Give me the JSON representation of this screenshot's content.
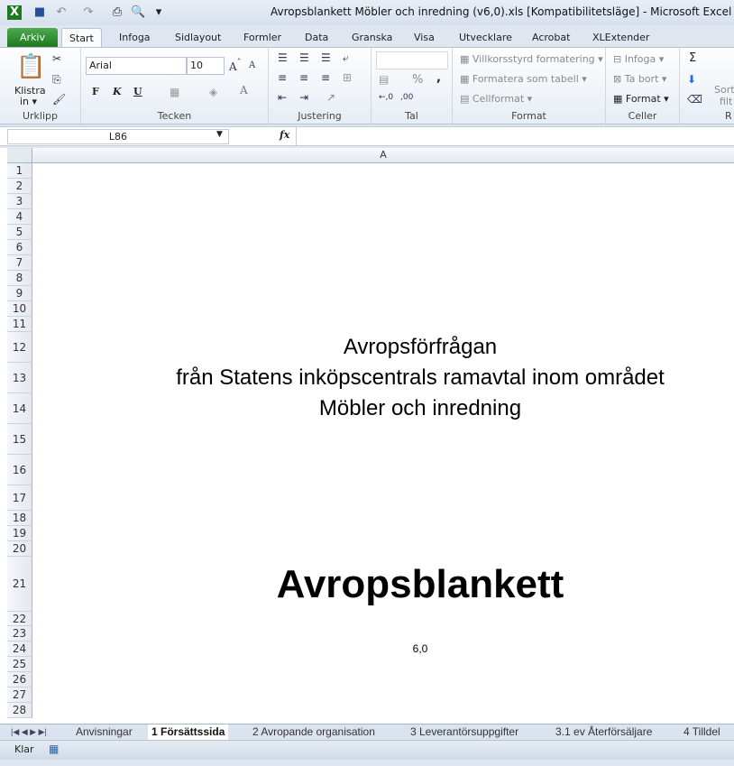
{
  "window": {
    "title": "Avropsblankett Möbler och inredning (v6,0).xls  [Kompatibilitetsläge]  -  Microsoft Excel"
  },
  "ribbon_tabs": [
    "Arkiv",
    "Start",
    "Infoga",
    "Sidlayout",
    "Formler",
    "Data",
    "Granska",
    "Visa",
    "Utvecklare",
    "Acrobat",
    "XLExtender"
  ],
  "active_tab": "Start",
  "ribbon": {
    "clipboard": {
      "paste": "Klistra",
      "paste2": "in ▾",
      "label": "Urklipp"
    },
    "font": {
      "name": "Arial",
      "size": "10",
      "bold": "F",
      "italic": "K",
      "underline": "U",
      "label": "Tecken"
    },
    "alignment": {
      "label": "Justering"
    },
    "number": {
      "format": "",
      "percent": "%",
      "comma": ",",
      "label": "Tal"
    },
    "styles": {
      "conditional": "Villkorsstyrd formatering",
      "table": "Formatera som tabell",
      "cellstyle": "Cellformat",
      "label": "Format"
    },
    "cells": {
      "insert": "Infoga",
      "delete": "Ta bort",
      "format": "Format",
      "label": "Celler"
    },
    "editing": {
      "sum": "Σ",
      "sort": "Sort",
      "filt": "filt",
      "label": "R"
    }
  },
  "formula_bar": {
    "name_box": "L86",
    "fx": "fx",
    "value": ""
  },
  "sheet": {
    "column": "A",
    "rows": [
      "1",
      "2",
      "3",
      "4",
      "5",
      "6",
      "7",
      "8",
      "9",
      "10",
      "11",
      "12",
      "13",
      "14",
      "15",
      "16",
      "17",
      "18",
      "19",
      "20",
      "21",
      "22",
      "23",
      "24",
      "25",
      "26",
      "27",
      "28"
    ],
    "line1": "Avropsförfrågan",
    "line2": "från Statens inköpscentrals ramavtal inom området",
    "line3": "Möbler och inredning",
    "heading": "Avropsblankett",
    "version": "6,0"
  },
  "sheet_tabs": [
    "Anvisningar",
    "1 Försättssida",
    "2 Avropande organisation",
    "3 Leverantörsuppgifter",
    "3.1 ev Återförsäljare",
    "4 Tilldel"
  ],
  "active_sheet": "1 Försättssida",
  "status": {
    "ready": "Klar"
  }
}
